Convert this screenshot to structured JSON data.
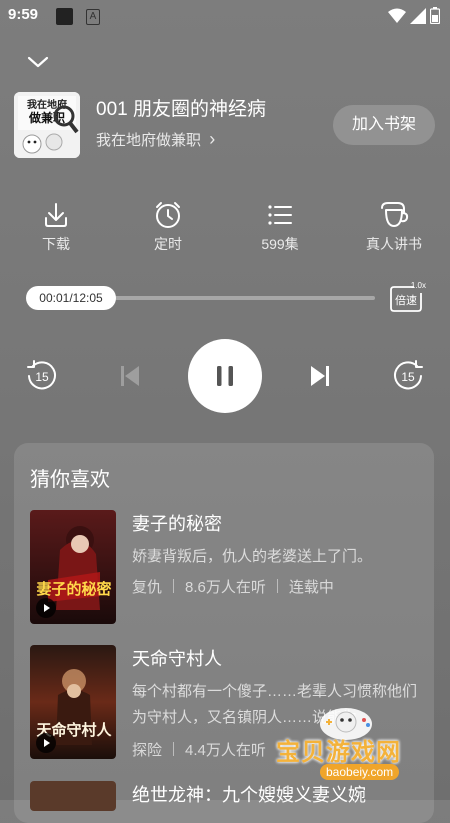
{
  "status_bar": {
    "time": "9:59",
    "notification_badge": "A"
  },
  "player": {
    "episode_title": "001 朋友圈的神经病",
    "book_title": "我在地府做兼职",
    "book_link_chevron": "›",
    "cover_text": "我在地府做兼职",
    "add_to_shelf": "加入书架"
  },
  "functions": [
    {
      "icon": "download-icon",
      "label": "下载"
    },
    {
      "icon": "timer-icon",
      "label": "定时"
    },
    {
      "icon": "playlist-icon",
      "label": "599集"
    },
    {
      "icon": "real-narrator-icon",
      "label": "真人讲书"
    }
  ],
  "progress": {
    "display": "00:01/12:05",
    "current": "00:01",
    "total": "12:05",
    "fraction": 0.0014
  },
  "speed": {
    "label": "倍速",
    "value": "1.0x"
  },
  "controls": {
    "rewind_seconds": "15",
    "forward_seconds": "15"
  },
  "recommend": {
    "title": "猜你喜欢",
    "items": [
      {
        "title": "妻子的秘密",
        "desc": "娇妻背叛后，仇人的老婆送上了门。",
        "tag": "复仇",
        "listeners": "8.6万人在听",
        "status": "连载中",
        "cover_text": "妻子的秘密"
      },
      {
        "title": "天命守村人",
        "desc": "每个村都有一个傻子……老辈人习惯称他们为守村人，又名镇阴人……说能为",
        "tag": "探险",
        "listeners": "4.4万人在听",
        "status": "",
        "cover_text": "天命守村人"
      },
      {
        "title": "绝世龙神：九个嫂嫂义妻义婉"
      }
    ]
  },
  "watermark": {
    "text": "宝贝游戏网",
    "url": "baobeiy.com"
  },
  "colors": {
    "background": "#7a7a7a",
    "card": "rgba(255,255,255,0.12)",
    "watermark": "#f4b23a"
  }
}
